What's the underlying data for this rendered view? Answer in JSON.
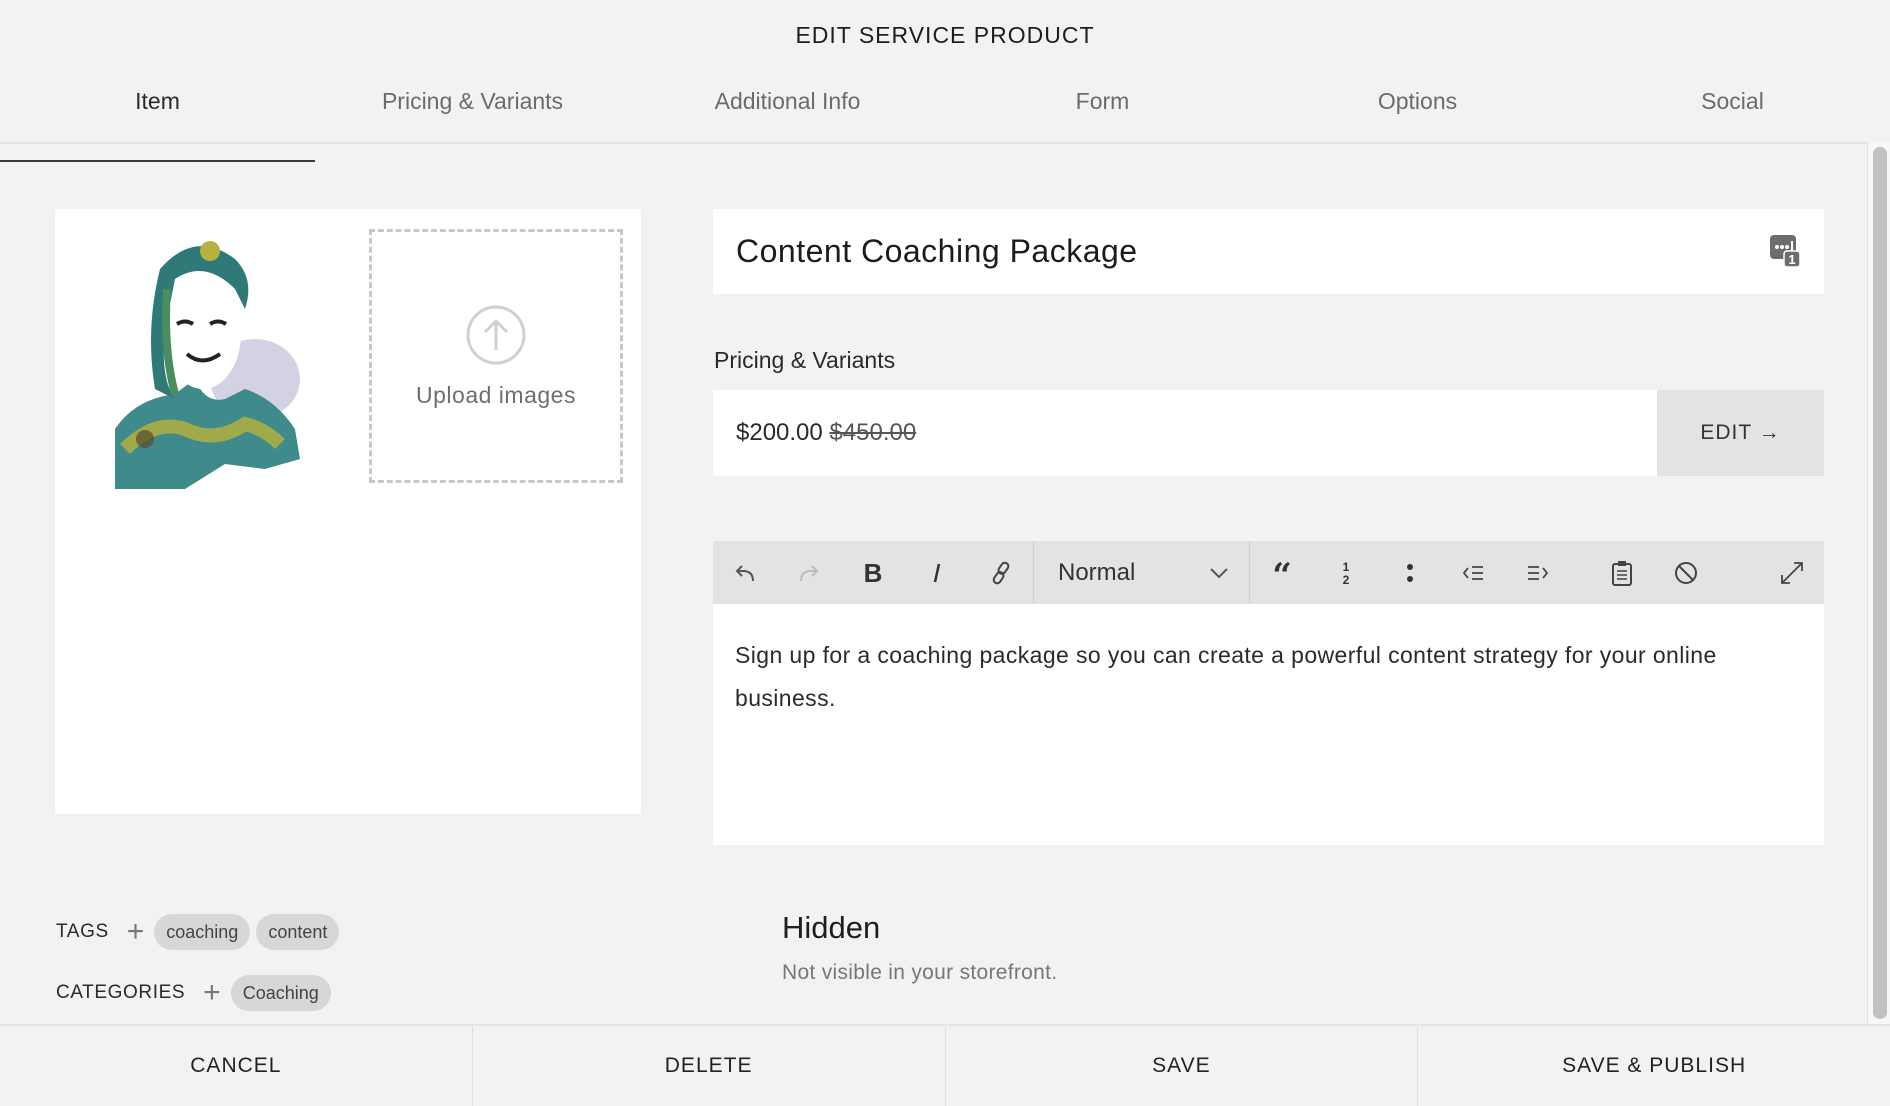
{
  "header": {
    "title": "EDIT SERVICE PRODUCT"
  },
  "tabs": [
    {
      "label": "Item",
      "active": true
    },
    {
      "label": "Pricing & Variants",
      "active": false
    },
    {
      "label": "Additional Info",
      "active": false
    },
    {
      "label": "Form",
      "active": false
    },
    {
      "label": "Options",
      "active": false
    },
    {
      "label": "Social",
      "active": false
    }
  ],
  "images": {
    "thumbnail_alt": "watercolor portrait",
    "upload_label": "Upload images",
    "upload_icon": "upload-arrow-icon"
  },
  "product": {
    "title": "Content Coaching Package",
    "title_icon": "lastpass-icon",
    "pricing_label": "Pricing & Variants",
    "price": "$200.00",
    "original_price": "$450.00",
    "edit_label": "EDIT →"
  },
  "editor": {
    "toolbar": [
      "undo-icon",
      "redo-icon",
      "bold-icon",
      "italic-icon",
      "link-icon",
      "quote-icon",
      "ordered-list-icon",
      "bullet-list-icon",
      "outdent-icon",
      "indent-icon",
      "paste-icon",
      "clear-format-icon",
      "expand-icon"
    ],
    "format_value": "Normal",
    "body": "Sign up for a coaching package so you can create a powerful content strategy for your online business."
  },
  "tags": {
    "label": "TAGS",
    "items": [
      "coaching",
      "content"
    ]
  },
  "categories": {
    "label": "CATEGORIES",
    "items": [
      "Coaching"
    ]
  },
  "visibility": {
    "title": "Hidden",
    "subtitle": "Not visible in your storefront."
  },
  "footer": {
    "cancel": "CANCEL",
    "delete": "DELETE",
    "save": "SAVE",
    "save_publish": "SAVE & PUBLISH"
  }
}
